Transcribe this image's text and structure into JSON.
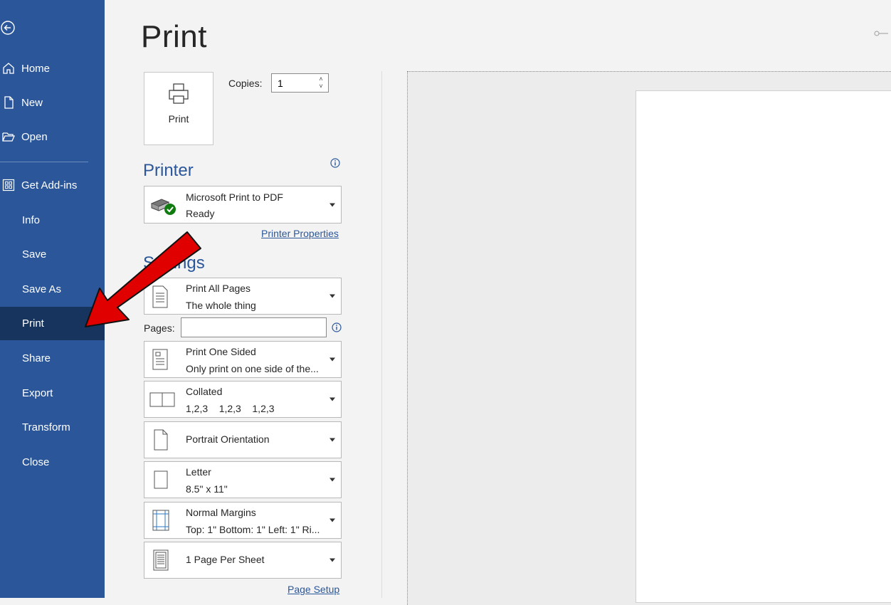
{
  "sidebar": {
    "items": [
      {
        "label": "Home",
        "icon": "home-icon"
      },
      {
        "label": "New",
        "icon": "new-document-icon"
      },
      {
        "label": "Open",
        "icon": "folder-open-icon"
      },
      {
        "label": "Get Add-ins",
        "icon": "add-ins-icon"
      },
      {
        "label": "Info"
      },
      {
        "label": "Save"
      },
      {
        "label": "Save As"
      },
      {
        "label": "Print",
        "active": true
      },
      {
        "label": "Share"
      },
      {
        "label": "Export"
      },
      {
        "label": "Transform"
      },
      {
        "label": "Close"
      }
    ],
    "bg_color": "#2b579a",
    "active_color": "#17345f"
  },
  "main": {
    "title": "Print",
    "print_button_label": "Print",
    "copies_label": "Copies:",
    "copies_value": "1",
    "printer_heading": "Printer",
    "printer": {
      "name": "Microsoft Print to PDF",
      "status": "Ready"
    },
    "printer_properties_link": "Printer Properties",
    "settings_heading": "Settings",
    "settings": [
      {
        "line1": "Print All Pages",
        "line2": "The whole thing",
        "icon": "page-range-icon"
      },
      {
        "line1": "Print One Sided",
        "line2": "Only print on one side of the...",
        "icon": "one-sided-icon"
      },
      {
        "line1": "Collated",
        "line2": "1,2,3    1,2,3    1,2,3",
        "icon": "collated-icon"
      },
      {
        "line1": "Portrait Orientation",
        "line2": "",
        "icon": "portrait-icon"
      },
      {
        "line1": "Letter",
        "line2": "8.5\" x 11\"",
        "icon": "paper-size-icon"
      },
      {
        "line1": "Normal Margins",
        "line2": "Top: 1\" Bottom: 1\" Left: 1\" Ri...",
        "icon": "margins-icon"
      },
      {
        "line1": "1 Page Per Sheet",
        "line2": "",
        "icon": "pages-per-sheet-icon"
      }
    ],
    "pages_label": "Pages:",
    "pages_value": "",
    "page_setup_link": "Page Setup"
  },
  "colors": {
    "accent": "#2b579a",
    "annotation_arrow": "#e00000"
  }
}
